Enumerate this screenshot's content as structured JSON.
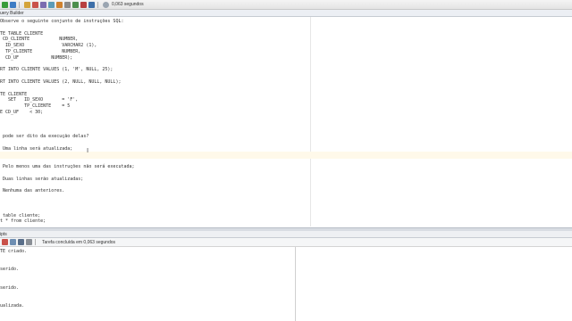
{
  "toolbar": {
    "timing": "0,063 segundos"
  },
  "tab": {
    "label": "uery Builder"
  },
  "editor": {
    "lines": [
      "Observe o seguinte conjunto de instruções SQL:",
      "",
      "TE TABLE CLIENTE",
      " CD_CLIENTE           NUMBER,",
      "  ID_SEXO              VARCHAR2 (1),",
      "  TP_CLIENTE           NUMBER,",
      "  CD_UF            NUMBER);",
      "",
      "RT INTO CLIENTE VALUES (1, 'M', NULL, 25);",
      "",
      "RT INTO CLIENTE VALUES (2, NULL, NULL, NULL);",
      "",
      "TE CLIENTE",
      "   SET   ID_SEXO       = 'F',",
      "         TP_CLIENTE    = 5",
      "E CD_UF    < 30;",
      "",
      "",
      "",
      " pode ser dito da execução delas?",
      "",
      " Uma linha será atualizada;",
      "",
      "",
      " Pelo menos uma das instruções não será executada;",
      "",
      " Duas linhas serão atualizadas;",
      "",
      " Nenhuma das anteriores.",
      "",
      "",
      "",
      " table cliente;",
      "t * from cliente;"
    ]
  },
  "output_panel": {
    "tab_label": "ipts",
    "status": "Tarefa concluída em 0,063 segundos",
    "lines": [
      "TE criado.",
      "",
      "",
      "serido.",
      "",
      "",
      "serido.",
      "",
      "",
      "ualizada."
    ]
  },
  "colors": {
    "caret_line": "#fff9ea",
    "toolbar_bg": "#ececec"
  }
}
